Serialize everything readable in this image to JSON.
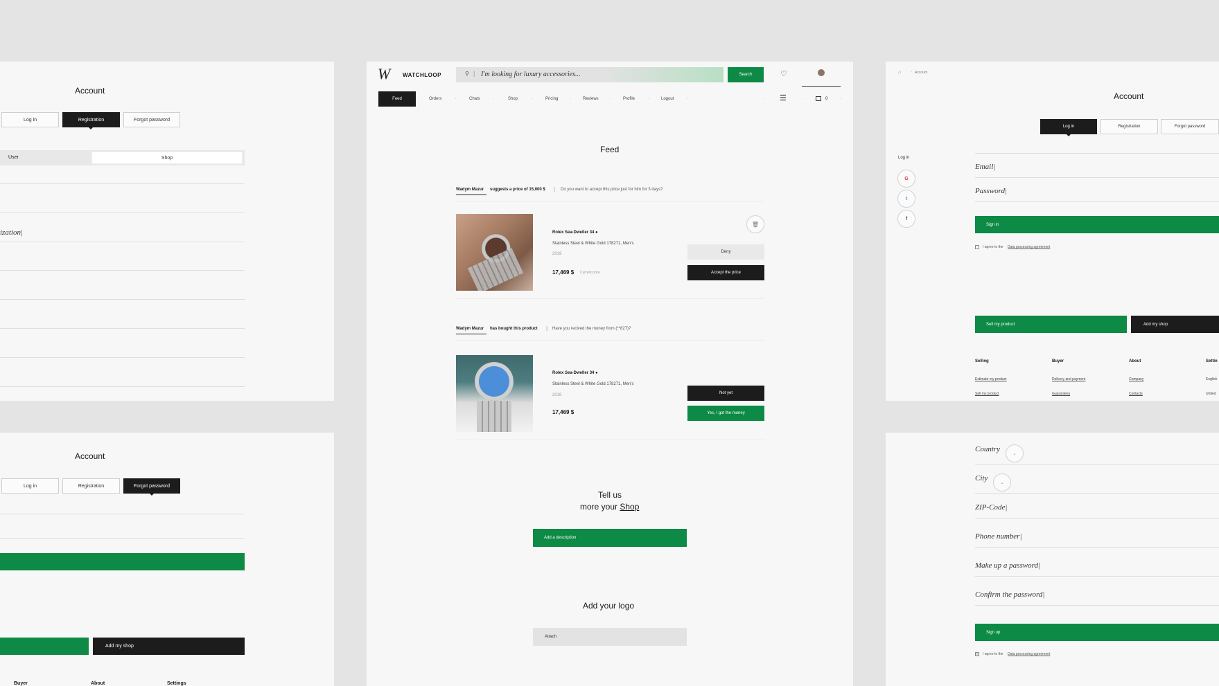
{
  "left_top": {
    "title": "Account",
    "tabs": [
      "Log in",
      "Registration",
      "Forgot password"
    ],
    "toggle": [
      "User",
      "Shop"
    ],
    "organization_field": "ization|"
  },
  "left_bottom": {
    "title": "Account",
    "tabs": [
      "Log in",
      "Registration",
      "Forgot password"
    ],
    "add_shop": "Add my shop",
    "footer": [
      "Buyer",
      "About",
      "Settings"
    ]
  },
  "center": {
    "brand": "WATCHLOOP",
    "search_placeholder": "I'm looking for luxury accessories...",
    "search_button": "Search",
    "cart_count": "0",
    "nav": [
      "Feed",
      "Orders",
      "Chats",
      "Shop",
      "Pricing",
      "Reviews",
      "Profile",
      "Logout"
    ],
    "page_title": "Feed",
    "notice1": {
      "user": "Wadym Mazur",
      "action": "suggests a price of 15,000 $",
      "question": "Do you want to accept this price just for him for 3 days?"
    },
    "item1": {
      "name": "Rolex  Sea-Dweller  34 ●",
      "desc": "Stainless Steel & White Gold  178271, Men's",
      "year": "2019",
      "price": "17,469 $",
      "price_label": "Current price",
      "btn_deny": "Deny",
      "btn_accept": "Accept the price"
    },
    "notice2": {
      "user": "Wadym Mazur",
      "action": "has bought this product",
      "question": "Have you recived the money from (**827)?"
    },
    "item2": {
      "name": "Rolex  Sea-Dweller  34 ●",
      "desc": "Stainless Steel & White Gold  178271, Men's",
      "year": "2019",
      "price": "17,469 $",
      "btn_no": "Not yet",
      "btn_yes": "Yes, I got the money"
    },
    "tell_line1": "Tell us",
    "tell_line2": "more your",
    "tell_link": "Shop",
    "add_desc": "Add a description",
    "logo_title": "Add your logo",
    "attach": "Attach"
  },
  "right_top": {
    "breadcrumb": "Account",
    "title": "Account",
    "tabs": [
      "Log in",
      "Registration",
      "Forgot password"
    ],
    "login_label": "Log in",
    "social": [
      "G",
      "t",
      "f"
    ],
    "email": "Email|",
    "password": "Password|",
    "sign_in": "Sign in",
    "agree_prefix": "I agree to the",
    "agree_link": "Data processing agreement",
    "sell": "Sell my product",
    "add_shop": "Add my shop",
    "footer_cols": [
      {
        "title": "Selling",
        "links": [
          "Estimate my product",
          "Sell my product"
        ]
      },
      {
        "title": "Buyer",
        "links": [
          "Delivery and payment",
          "Guarantees"
        ]
      },
      {
        "title": "About",
        "links": [
          "Company",
          "Contacts"
        ]
      },
      {
        "title": "Settin",
        "links": [
          "English",
          "United"
        ]
      }
    ]
  },
  "right_bottom": {
    "country": "Country",
    "city": "City",
    "zip": "ZIP-Code|",
    "phone": "Phone number|",
    "password": "Make up a password|",
    "confirm": "Confirm the password|",
    "sign_up": "Sign up",
    "agree_prefix": "I agree to the",
    "agree_link": "Data processing agreement"
  },
  "colors": {
    "green": "#0d8a45",
    "dark": "#1c1c1c",
    "bg": "#e4e4e4",
    "panel": "#f7f7f7"
  }
}
